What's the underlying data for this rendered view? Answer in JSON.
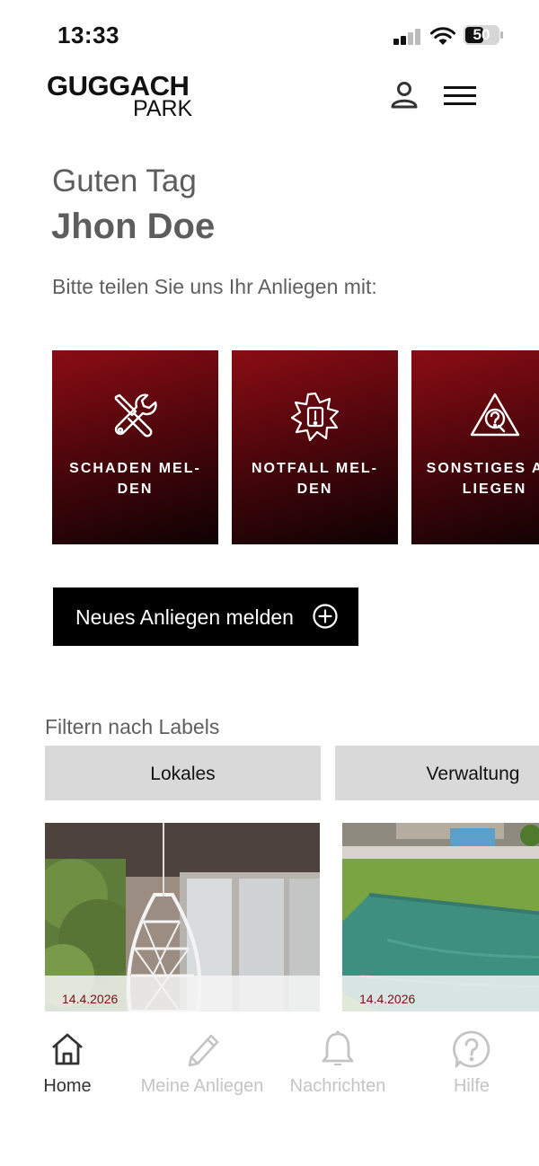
{
  "status_bar": {
    "time": "13:33",
    "battery": "50"
  },
  "header": {
    "logo_top": "GUGGACH",
    "logo_bottom": "PARK"
  },
  "greeting": {
    "hello": "Guten Tag",
    "name": "Jhon Doe",
    "prompt": "Bitte teilen Sie uns Ihr Anliegen mit:"
  },
  "categories": [
    {
      "line1": "SCHADEN MEL-",
      "line2": "DEN",
      "icon": "tools-icon"
    },
    {
      "line1": "NOTFALL MEL-",
      "line2": "DEN",
      "icon": "emergency-icon"
    },
    {
      "line1": "SONSTIGES AN-",
      "line2": "LIEGEN",
      "icon": "question-warning-icon"
    }
  ],
  "new_issue": {
    "label": "Neues Anliegen melden"
  },
  "filters": {
    "title": "Filtern nach Labels",
    "chips": [
      "Lokales",
      "Verwaltung"
    ]
  },
  "news": [
    {
      "date": "14.4.2026"
    },
    {
      "date": "14.4.2026"
    }
  ],
  "nav": {
    "items": [
      {
        "label": "Home",
        "active": true
      },
      {
        "label": "Meine Anliegen",
        "active": false
      },
      {
        "label": "Nachrichten",
        "active": false
      },
      {
        "label": "Hilfe",
        "active": false
      }
    ]
  },
  "colors": {
    "accent": "#7a1016",
    "nav_active": "#333333",
    "nav_inactive": "#c4c4c4"
  }
}
